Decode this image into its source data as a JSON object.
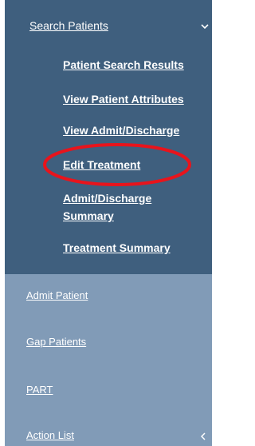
{
  "sidebar": {
    "search_patients": {
      "label": "Search Patients",
      "icon": "chevron-down-icon",
      "expanded": true,
      "subitems": [
        {
          "label": "Patient Search Results"
        },
        {
          "label": "View Patient Attributes"
        },
        {
          "label": "View Admit/Discharge"
        },
        {
          "label": "Edit Treatment"
        },
        {
          "label": "Admit/Discharge Summary"
        },
        {
          "label": "Treatment Summary"
        }
      ]
    },
    "items": [
      {
        "label": "Admit Patient"
      },
      {
        "label": "Gap Patients"
      },
      {
        "label": "PART"
      },
      {
        "label": "Action List",
        "icon": "chevron-left-icon"
      }
    ]
  },
  "annotation": {
    "highlight_color": "#e8141c",
    "target": "Edit Treatment"
  },
  "colors": {
    "panel_dark": "#3f5f7e",
    "panel_light": "#819bb7",
    "text": "#ffffff"
  }
}
